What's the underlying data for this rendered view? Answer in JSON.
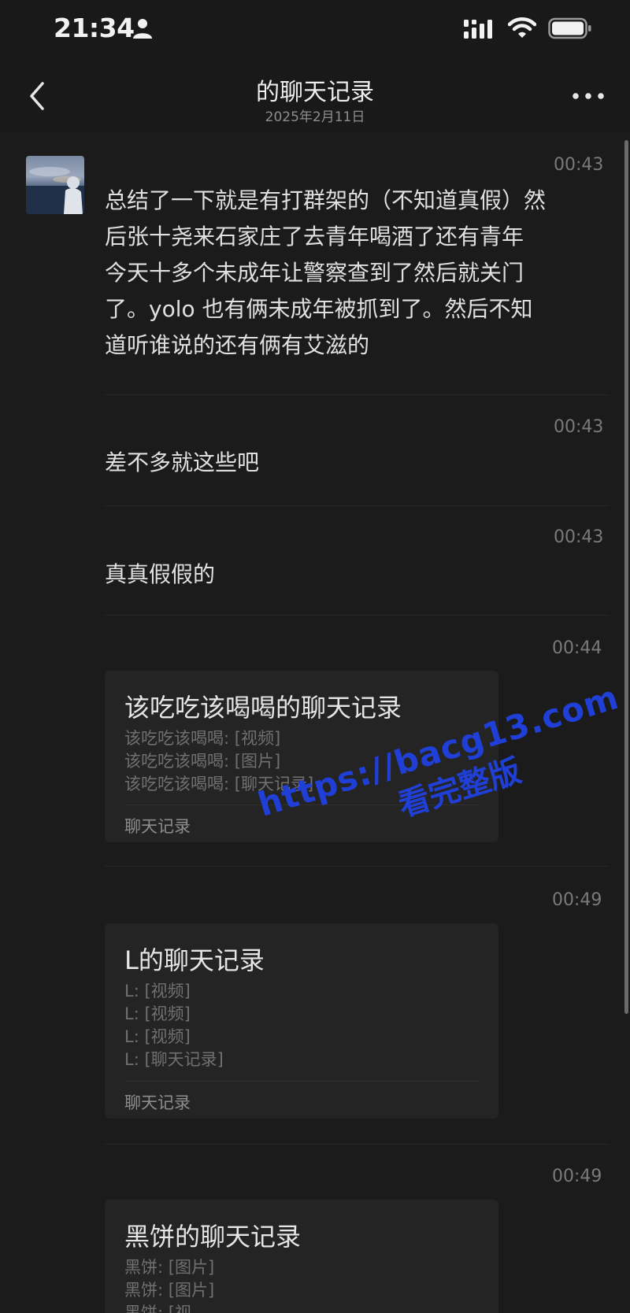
{
  "status_bar": {
    "time": "21:34"
  },
  "nav": {
    "title": "的聊天记录",
    "subtitle": "2025年2月11日"
  },
  "messages": [
    {
      "time": "00:43",
      "lines": [
        "总结了一下就是有打群架的（不知道真假）然",
        "后张十尧来石家庄了去青年喝酒了还有青年",
        "今天十多个未成年让警察查到了然后就关门",
        "了。yolo 也有俩未成年被抓到了。然后不知",
        "道听谁说的还有俩有艾滋的"
      ]
    },
    {
      "time": "00:43",
      "text": "差不多就这些吧"
    },
    {
      "time": "00:43",
      "text": "真真假假的"
    }
  ],
  "records": [
    {
      "time": "00:44",
      "title": "该吃吃该喝喝的聊天记录",
      "lines": [
        "该吃吃该喝喝: [视频]",
        "该吃吃该喝喝: [图片]",
        "该吃吃该喝喝: [聊天记录]"
      ],
      "footer": "聊天记录"
    },
    {
      "time": "00:49",
      "title": "L的聊天记录",
      "lines": [
        "L: [视频]",
        "L: [视频]",
        "L: [视频]",
        "L: [聊天记录]"
      ],
      "footer": "聊天记录"
    },
    {
      "time": "00:49",
      "title": "黑饼的聊天记录",
      "lines": [
        "黑饼: [图片]",
        "黑饼: [图片]",
        "黑饼: [视"
      ]
    }
  ],
  "watermark": {
    "url": "https://bacg13.com",
    "text": "看完整版"
  }
}
